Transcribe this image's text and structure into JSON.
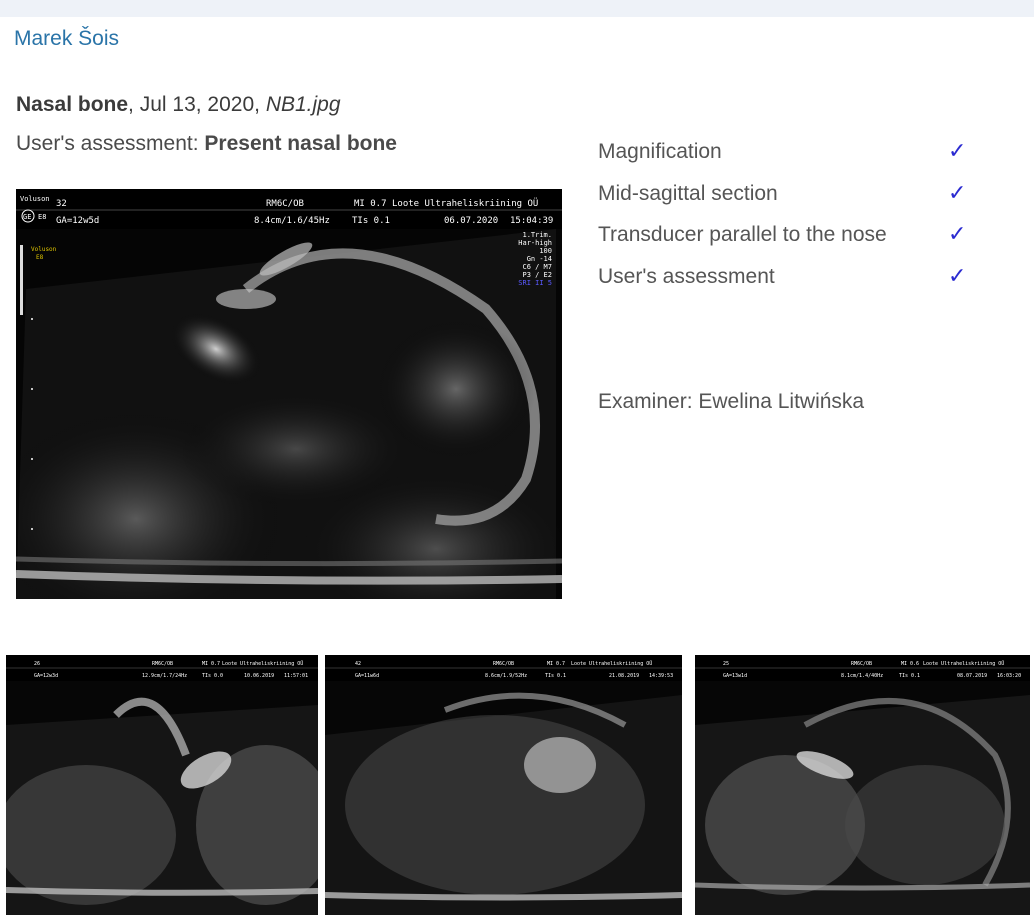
{
  "header": {
    "user_name": "Marek Šois"
  },
  "record": {
    "title": "Nasal bone",
    "date": ", Jul 13, 2020, ",
    "filename": "NB1.jpg",
    "assessment_label": "User's assessment: ",
    "assessment_value": "Present nasal bone"
  },
  "checklist": {
    "items": [
      {
        "label": "Magnification",
        "icon": "checkmark-icon",
        "mark": "✓"
      },
      {
        "label": "Mid-sagittal section",
        "icon": "checkmark-icon",
        "mark": "✓"
      },
      {
        "label": "Transducer parallel to the nose",
        "icon": "checkmark-icon",
        "mark": "✓"
      },
      {
        "label": "User's assessment",
        "icon": "checkmark-icon",
        "mark": "✓"
      }
    ],
    "check_color": "#2b2bd1"
  },
  "examiner": "Examiner: Ewelina Litwińska",
  "main_image": {
    "brand": "Voluson",
    "logo": "GE",
    "logo_sub": "E8",
    "depth_num": "32",
    "ga": "GA=12w5d",
    "probe": "RM6C/OB",
    "mi": "MI 0.7",
    "clinic": "Loote Ultraheliskriining OÜ",
    "params": "8.4cm/1.6/45Hz",
    "tis": "TIs 0.1",
    "date": "06.07.2020",
    "time": "15:04:39",
    "side_brand": "Voluson",
    "side_sub": "E8",
    "settings": [
      "1.Trim.",
      "Har-high",
      "100",
      "Gn -14",
      "C6 / M7",
      "P3 / E2",
      "SRI II 5"
    ]
  },
  "thumbnails": [
    {
      "num": "26",
      "ga": "GA=12w3d",
      "probe": "RM6C/OB",
      "mi": "MI 0.7",
      "clinic": "Loote Ultraheliskriining OÜ",
      "params": "12.9cm/1.7/24Hz",
      "tis": "TIs 0.0",
      "date": "10.06.2019",
      "time": "11:57:01"
    },
    {
      "num": "42",
      "ga": "GA=11w6d",
      "probe": "RM6C/OB",
      "mi": "MI 0.7",
      "clinic": "Loote Ultraheliskriining OÜ",
      "params": "8.6cm/1.9/52Hz",
      "tis": "TIs 0.1",
      "date": "21.08.2019",
      "time": "14:39:53"
    },
    {
      "num": "25",
      "ga": "GA=13w1d",
      "probe": "RM6C/OB",
      "mi": "MI 0.6",
      "clinic": "Loote Ultraheliskriining OÜ",
      "params": "8.1cm/1.4/40Hz",
      "tis": "TIs 0.1",
      "date": "08.07.2019",
      "time": "16:03:20"
    }
  ]
}
